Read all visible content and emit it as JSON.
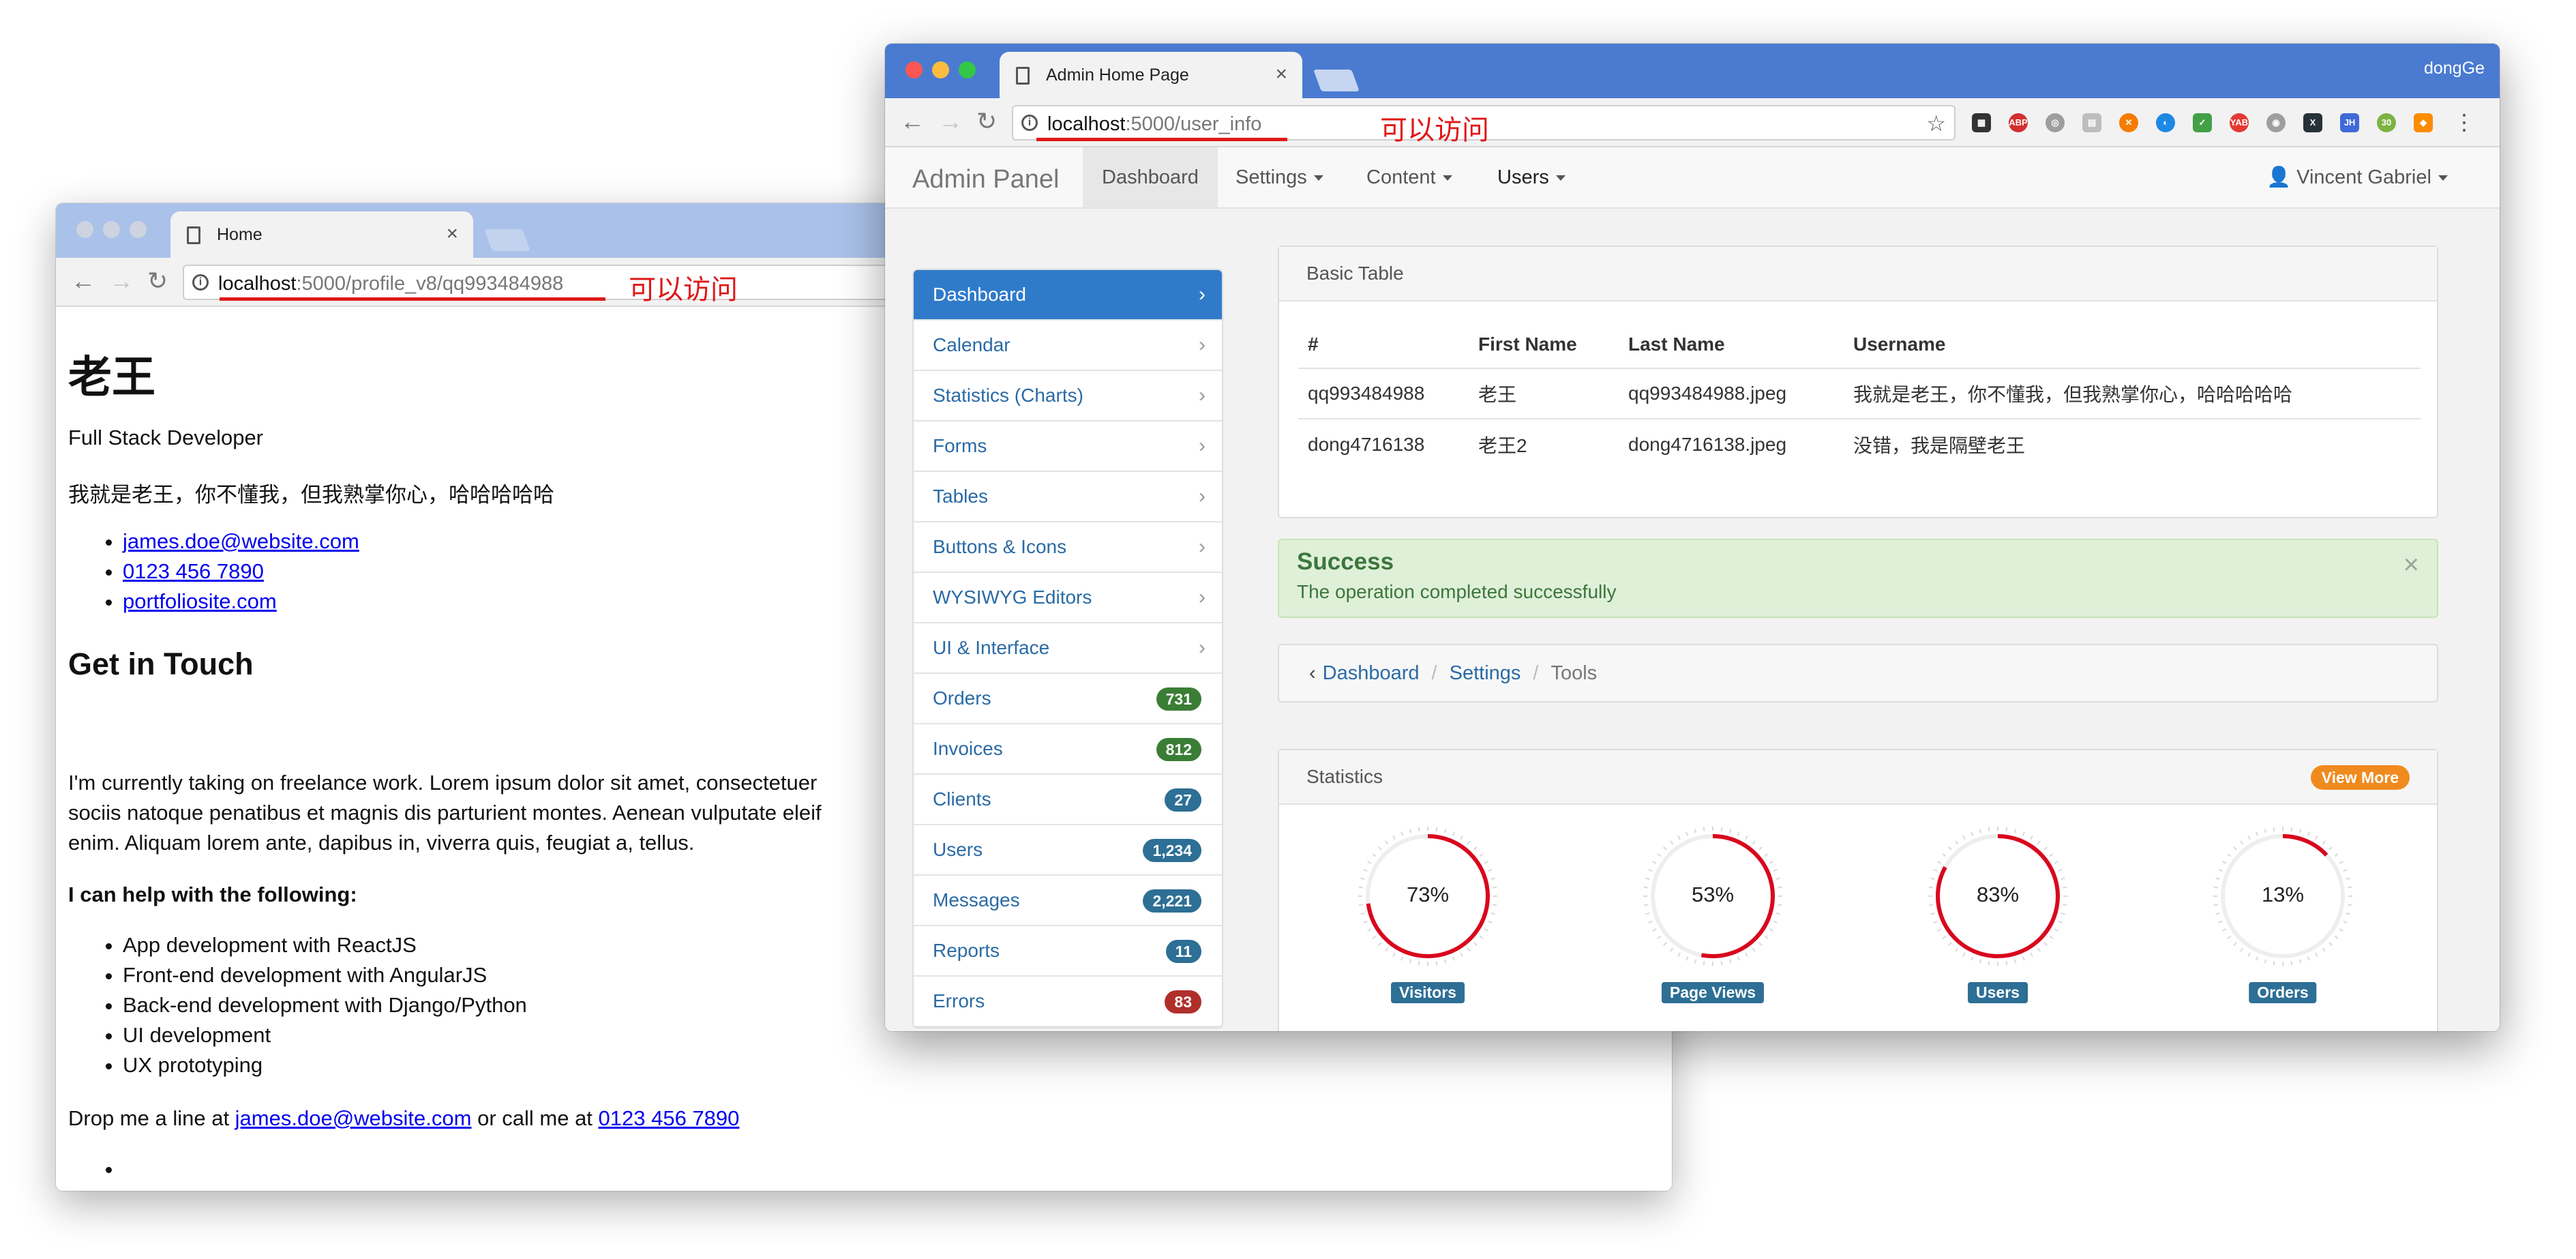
{
  "home_window": {
    "tab_title": "Home",
    "url_host": "localhost",
    "url_path": ":5000/profile_v8/qq993484988",
    "annotation": "可以访问",
    "name": "老王",
    "title": "Full Stack Developer",
    "bio": "我就是老王，你不懂我，但我熟掌你心，哈哈哈哈哈",
    "contacts": [
      "james.doe@website.com",
      "0123 456 7890",
      "portfoliosite.com"
    ],
    "get_in_touch": "Get in Touch",
    "freelance_line1": "I'm currently taking on freelance work. Lorem ipsum dolor sit amet, consectetuer",
    "freelance_line2": "sociis natoque penatibus et magnis dis parturient montes. Aenean vulputate eleif",
    "freelance_line3": "enim. Aliquam lorem ante, dapibus in, viverra quis, feugiat a, tellus.",
    "help_heading": "I can help with the following:",
    "skills": [
      "App development with ReactJS",
      "Front-end development with AngularJS",
      "Back-end development with Django/Python",
      "UI development",
      "UX prototyping"
    ],
    "drop_prefix": "Drop me a line at ",
    "drop_email": "james.doe@website.com",
    "drop_mid": " or call me at ",
    "drop_phone": "0123 456 7890"
  },
  "admin_window": {
    "tab_title": "Admin Home Page",
    "profile": "dongGe",
    "url_host": "localhost",
    "url_path": ":5000/user_info",
    "annotation": "可以访问",
    "brand": "Admin Panel",
    "nav": {
      "dashboard": "Dashboard",
      "settings": "Settings",
      "content": "Content",
      "users": "Users",
      "user": "Vincent Gabriel"
    },
    "sidebar": [
      {
        "label": "Dashboard"
      },
      {
        "label": "Calendar"
      },
      {
        "label": "Statistics (Charts)"
      },
      {
        "label": "Forms"
      },
      {
        "label": "Tables"
      },
      {
        "label": "Buttons & Icons"
      },
      {
        "label": "WYSIWYG Editors"
      },
      {
        "label": "UI & Interface"
      },
      {
        "label": "Orders",
        "badge": "731",
        "color": "#3a7d35"
      },
      {
        "label": "Invoices",
        "badge": "812",
        "color": "#3a7d35"
      },
      {
        "label": "Clients",
        "badge": "27",
        "color": "#2d6f95"
      },
      {
        "label": "Users",
        "badge": "1,234",
        "color": "#2d6f95"
      },
      {
        "label": "Messages",
        "badge": "2,221",
        "color": "#2d6f95"
      },
      {
        "label": "Reports",
        "badge": "11",
        "color": "#2d6f95"
      },
      {
        "label": "Errors",
        "badge": "83",
        "color": "#b12f2b"
      }
    ],
    "table": {
      "title": "Basic Table",
      "headers": [
        "#",
        "First Name",
        "Last Name",
        "Username"
      ],
      "rows": [
        [
          "qq993484988",
          "老王",
          "qq993484988.jpeg",
          "我就是老王，你不懂我，但我熟掌你心，哈哈哈哈哈"
        ],
        [
          "dong4716138",
          "老王2",
          "dong4716138.jpeg",
          "没错，我是隔壁老王"
        ]
      ]
    },
    "alert": {
      "title": "Success",
      "message": "The operation completed successfully",
      "close": "×"
    },
    "breadcrumb": [
      "Dashboard",
      "Settings",
      "Tools"
    ],
    "stats": {
      "title": "Statistics",
      "button": "View More",
      "gauges": [
        {
          "label": "Visitors",
          "value": 73
        },
        {
          "label": "Page Views",
          "value": 53
        },
        {
          "label": "Users",
          "value": 83
        },
        {
          "label": "Orders",
          "value": 13
        }
      ]
    }
  },
  "colors": {
    "accent_red": "#e01818",
    "primary_blue": "#2f7bc9",
    "gauge_red": "#d9071d"
  }
}
